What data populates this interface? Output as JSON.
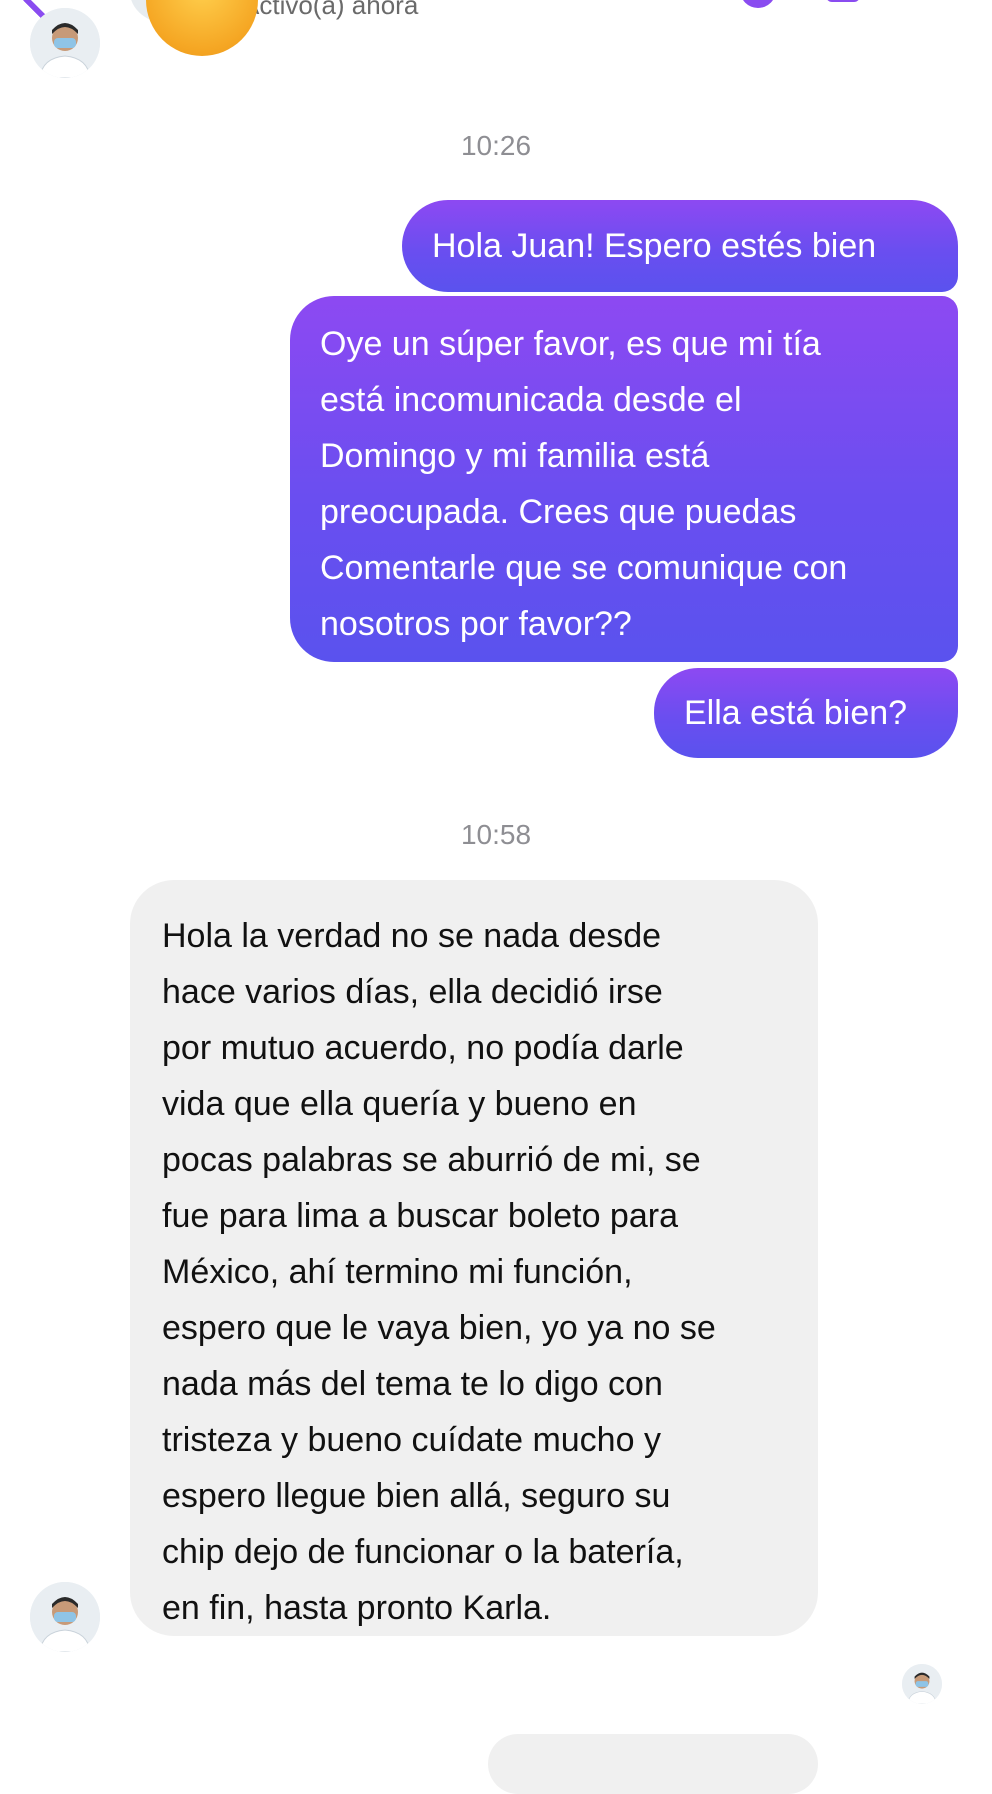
{
  "header": {
    "contact_status": "Activo(a) ahora",
    "back_icon": "back-arrow-icon",
    "call_icon": "phone-icon",
    "video_icon": "video-camera-icon"
  },
  "colors": {
    "accent": "#8a4cf0",
    "outgoing_top": "#8d49f2",
    "outgoing_bottom": "#5a52ee",
    "incoming_bg": "#f0f0f0",
    "timestamp": "#8e8e93"
  },
  "conversation": {
    "timestamp_1": "10:26",
    "outgoing": [
      {
        "lines": [
          "Hola Juan! Espero estés bien"
        ]
      },
      {
        "lines": [
          "Oye un súper favor, es que mi tía",
          "está incomunicada desde el",
          "Domingo y mi familia está",
          "preocupada. Crees que puedas",
          "Comentarle que se comunique con",
          "nosotros por favor??"
        ]
      },
      {
        "lines": [
          "Ella está bien?"
        ]
      }
    ],
    "timestamp_2": "10:58",
    "incoming": [
      {
        "lines": [
          "Hola la verdad no se nada desde",
          "hace varios días, ella decidió irse",
          "por mutuo acuerdo, no podía darle",
          "vida que ella quería y bueno en",
          "pocas palabras se aburrió de mi, se",
          "fue para lima a buscar boleto para",
          "México, ahí termino mi función,",
          "espero que le vaya bien, yo ya no se",
          "nada más del tema te lo digo con",
          "tristeza y bueno cuídate mucho y",
          "espero llegue bien allá, seguro su",
          "chip dejo de funcionar o la batería,",
          "en fin, hasta pronto Karla."
        ]
      }
    ]
  }
}
